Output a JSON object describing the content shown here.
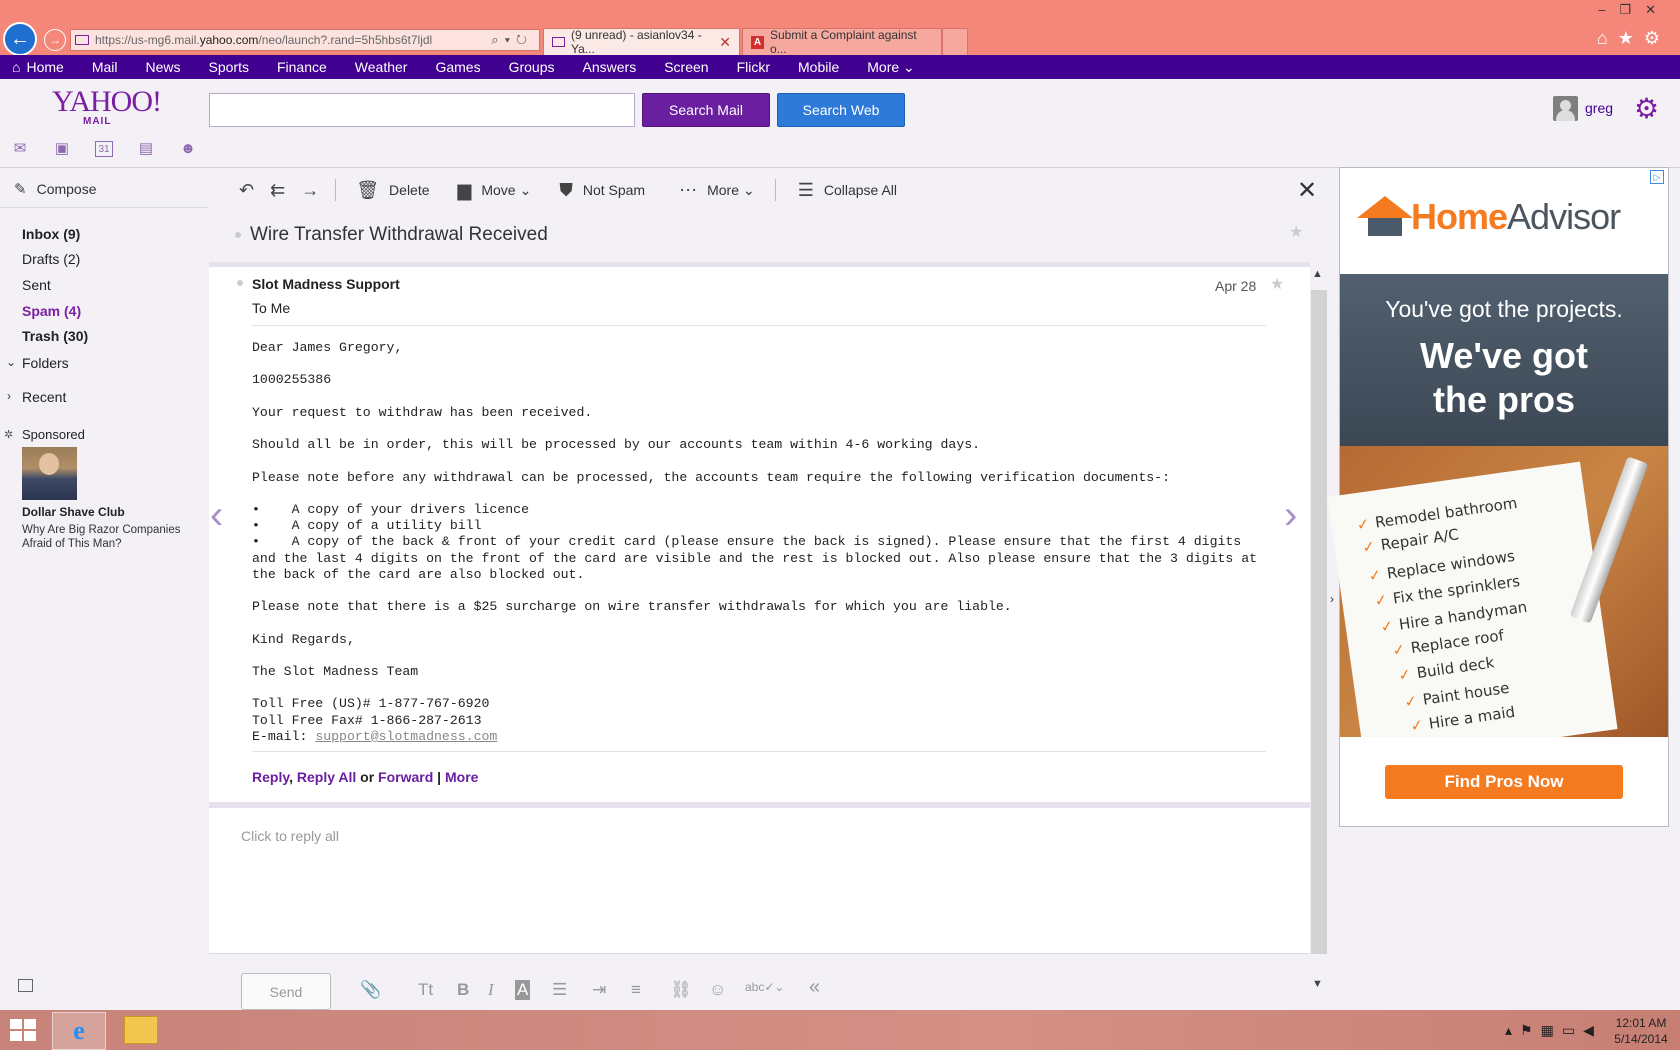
{
  "browser": {
    "address_prefix": "https://us-mg6.mail.",
    "address_domain": "yahoo.com",
    "address_suffix": "/neo/launch?.rand=5h5hbs6t7ljdl",
    "tabs": [
      {
        "label": "(9 unread) - asianlov34 - Ya...",
        "active": true
      },
      {
        "label": "Submit a Complaint against o...",
        "active": false
      }
    ]
  },
  "yahoo_nav": {
    "items": [
      "Home",
      "Mail",
      "News",
      "Sports",
      "Finance",
      "Weather",
      "Games",
      "Groups",
      "Answers",
      "Screen",
      "Flickr",
      "Mobile",
      "More"
    ]
  },
  "header": {
    "logo": "YAHOO!",
    "logo_sub": "MAIL",
    "search_placeholder": "",
    "search_mail_label": "Search Mail",
    "search_web_label": "Search Web",
    "username": "greg"
  },
  "sidebar": {
    "compose_label": "Compose",
    "folders": [
      {
        "label": "Inbox (9)"
      },
      {
        "label": "Drafts (2)"
      },
      {
        "label": "Sent"
      },
      {
        "label": "Spam (4)"
      },
      {
        "label": "Trash (30)"
      }
    ],
    "folders_label": "Folders",
    "recent_label": "Recent",
    "sponsored_label": "Sponsored",
    "sponsor_name": "Dollar Shave Club",
    "sponsor_text": "Why Are Big Razor Companies Afraid of This Man?"
  },
  "toolbar": {
    "delete_label": "Delete",
    "move_label": "Move",
    "not_spam_label": "Not Spam",
    "more_label": "More",
    "collapse_label": "Collapse All"
  },
  "message": {
    "subject": "Wire Transfer Withdrawal Received",
    "sender": "Slot Madness Support",
    "recipients": "To  Me",
    "date": "Apr 28",
    "body": "Dear James Gregory,\n\n1000255386\n\nYour request to withdraw has been received.\n\nShould all be in order, this will be processed by our accounts team within 4-6 working days.\n\nPlease note before any withdrawal can be processed, the accounts team require the following verification documents-:\n\n•    A copy of your drivers licence\n•    A copy of a utility bill\n•    A copy of the back & front of your credit card (please ensure the back is signed). Please ensure that the first 4 digits and the last 4 digits on the front of the card are visible and the rest is blocked out. Also please ensure that the 3 digits at the back of the card are also blocked out.\n\nPlease note that there is a $25 surcharge on wire transfer withdrawals for which you are liable.\n\nKind Regards,\n\nThe Slot Madness Team\n\nToll Free (US)# 1-877-767-6920\nToll Free Fax# 1-866-287-2613\nE-mail: ",
    "email": "support@slotmadness.com",
    "reply": "Reply",
    "reply_all": "Reply All",
    "or": "or",
    "forward": "Forward",
    "more": "More"
  },
  "reply_box": {
    "placeholder": "Click to reply all",
    "send_label": "Send"
  },
  "ad": {
    "brand_home": "Home",
    "brand_advisor": "Advisor",
    "line1": "You've got the projects.",
    "line2a": "We've got",
    "line2b": "the pros",
    "items": [
      "Remodel bathroom",
      "Repair A/C",
      "Replace windows",
      "Fix the sprinklers",
      "Hire a handyman",
      "Replace roof",
      "Build deck",
      "Paint house",
      "Hire a maid"
    ],
    "cta": "Find Pros Now"
  },
  "taskbar": {
    "time": "12:01 AM",
    "date": "5/14/2014"
  }
}
